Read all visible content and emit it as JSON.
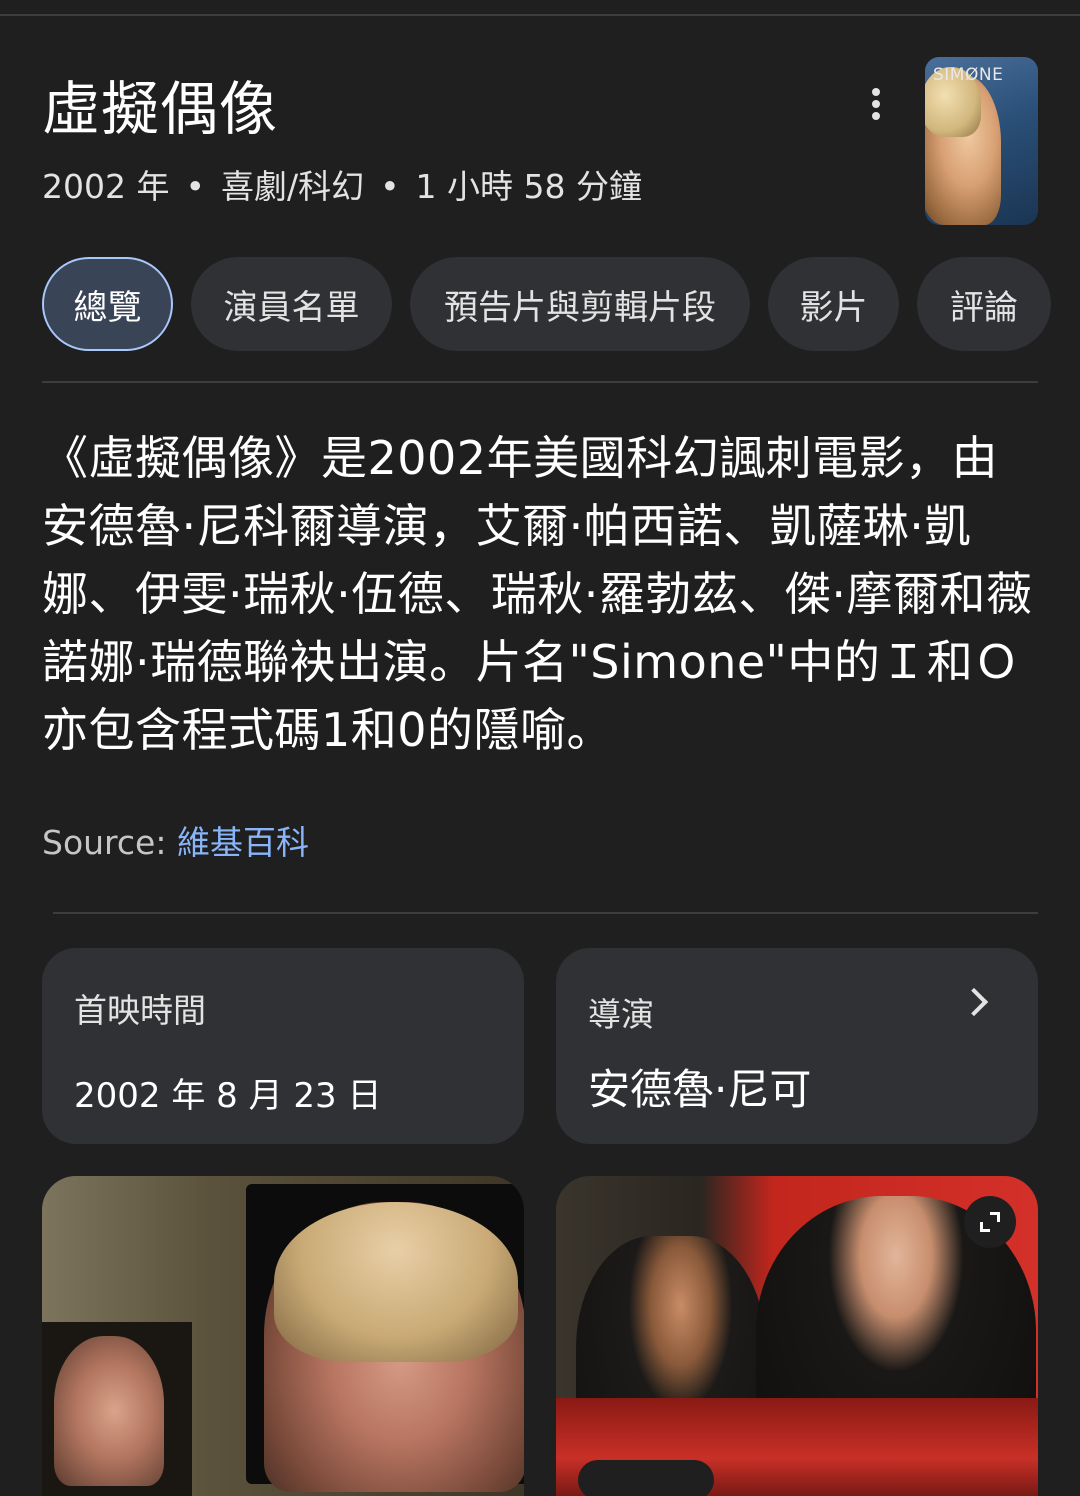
{
  "movie": {
    "title": "虛擬偶像",
    "year": "2002 年",
    "genre": "喜劇/科幻",
    "duration": "1 小時 58 分鐘",
    "separator": "•",
    "poster_text": "SIMØNE"
  },
  "tabs": [
    {
      "label": "總覽",
      "active": true
    },
    {
      "label": "演員名單",
      "active": false
    },
    {
      "label": "預告片與剪輯片段",
      "active": false
    },
    {
      "label": "影片",
      "active": false
    },
    {
      "label": "評論",
      "active": false
    }
  ],
  "description": "《虛擬偶像》是2002年美國科幻諷刺電影，由安德魯·尼科爾導演，艾爾·帕西諾、凱薩琳·凱娜、伊雯·瑞秋·伍德、瑞秋·羅勃茲、傑·摩爾和薇諾娜·瑞德聯袂出演。片名\"Simone\"中的Ｉ和Ｏ亦包含程式碼1和0的隱喻。",
  "source": {
    "label": "Source:",
    "link": "維基百科"
  },
  "info_cards": {
    "release": {
      "label": "首映時間",
      "value": "2002 年 8 月 23 日"
    },
    "director": {
      "label": "導演",
      "value": "安德魯·尼可"
    }
  },
  "icons": {
    "more": "more-vert-icon",
    "chevron": "chevron-right-icon",
    "expand": "expand-icon"
  },
  "colors": {
    "background": "#1f1f1f",
    "card": "#303134",
    "active_tab_border": "#a8c7fa",
    "link": "#8ab4f8"
  }
}
